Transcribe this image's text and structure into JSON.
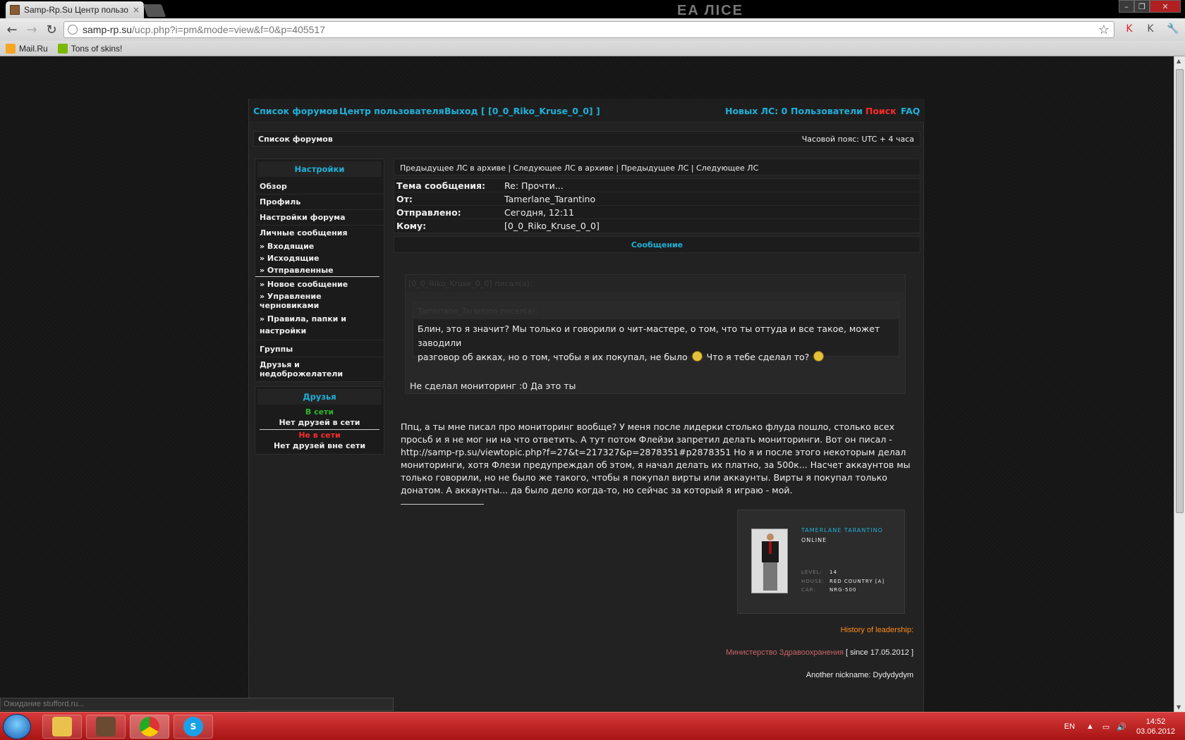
{
  "browser": {
    "tab_title": "Samp-Rp.Su Центр пользо",
    "tab_close": "×",
    "url_host": "samp-rp.su",
    "url_path": "/ucp.php?i=pm&mode=view&f=0&p=405517",
    "bookmarks": [
      {
        "label": "Mail.Ru",
        "icon": "mailru-icon",
        "color": "#f5a623"
      },
      {
        "label": "Tons of skins!",
        "icon": "speech-bubble-icon",
        "color": "#7ab800"
      }
    ],
    "status_text": "Ожидание stufford.ru..."
  },
  "topnav": {
    "forum_list": "Список форумов",
    "ucp": "Центр пользователя",
    "logout": "Выход [ [0_0_Riko_Kruse_0_0] ]",
    "new_pm": "Новых ЛС: 0",
    "users": "Пользователи",
    "search": "Поиск",
    "faq": "FAQ"
  },
  "crumb": {
    "label": "Список форумов",
    "timezone": "Часовой пояс: UTC + 4 часа"
  },
  "sidebar": {
    "settings_title": "Настройки",
    "items": [
      "Обзор",
      "Профиль",
      "Настройки форума",
      "Личные сообщения"
    ],
    "pm_sub": [
      "» Входящие",
      "» Исходящие",
      "» Отправленные",
      "» Новое сообщение",
      "» Управление черновиками",
      "» Правила, папки и настройки"
    ],
    "bottom_items": [
      "Группы",
      "Друзья и недоброжелатели"
    ],
    "friends_title": "Друзья",
    "online_label": "В сети",
    "online_none": "Нет друзей в сети",
    "offline_label": "Не в сети",
    "offline_none": "Нет друзей вне сети"
  },
  "pm": {
    "nav": "Предыдущее ЛС в архиве | Следующее ЛС в архиве | Предыдущее ЛС | Следующее ЛС",
    "meta": [
      {
        "label": "Тема сообщения:",
        "value": "Re: Прочти..."
      },
      {
        "label": "От:",
        "value": "Tamerlane_Tarantino"
      },
      {
        "label": "Отправлено:",
        "value": "Сегодня, 12:11"
      },
      {
        "label": "Кому:",
        "value": "[0_0_Riko_Kruse_0_0]"
      }
    ],
    "message_header": "Сообщение",
    "quote_outer_author": "[0_0_Riko_Kruse_0_0] писал(а):",
    "quote_inner_author": "Tamerlane_Tarantino писал(а):",
    "quote_inner_text_1": "Блин, это я значит? Мы только и говорили о чит-мастере, о том, что ты оттуда и все такое, может заводили",
    "quote_inner_text_2": "разговор об акках, но о том, чтобы я их покупал, не было",
    "quote_inner_text_3": "Что я тебе сделал то?",
    "quote_outer_text": "Не сделал мониторинг :0 Да это ты",
    "body": "Ппц, а ты мне писал про мониторинг вообще? У меня после лидерки столько флуда пошло, столько всех просьб и я не мог ни на что ответить. А тут потом Флейзи запретил делать мониторинги. Вот он писал - http://samp-rp.su/viewtopic.php?f=27&t=217327&p=2878351#p2878351 Но я и после этого некоторым делал мониторинги, хотя Флези предупреждал об этом, я начал делать их платно, за 500к... Насчет аккаунтов мы только говорили, но не было же такого, чтобы я покупал вирты или аккаунты. Вирты я покупал только донатом. А аккаунты... да было дело когда-то, но сейчас за который я играю - мой."
  },
  "signature": {
    "name": "TAMERLANE TARANTINO",
    "status": "ONLINE",
    "level_label": "LEVEL:",
    "level": "14",
    "house_label": "HOUSE:",
    "house": "RED COUNTRY [A]",
    "car_label": "CAR:",
    "car": "NRG-500",
    "history_label": "History of leadership:",
    "ministry": "Министерство Здравоохранения",
    "since": "[ since 17.05.2012 ]",
    "another_nick": "Another nickname: Dydydydym"
  },
  "taskbar": {
    "lang": "EN",
    "time": "14:52",
    "date": "03.06.2012"
  },
  "colors": {
    "accent": "#1fb0d8",
    "search": "#ff2a2a",
    "online": "#2db52d",
    "offline": "#ff2a2a",
    "history": "#ff8c1a",
    "ministry": "#c86464"
  }
}
